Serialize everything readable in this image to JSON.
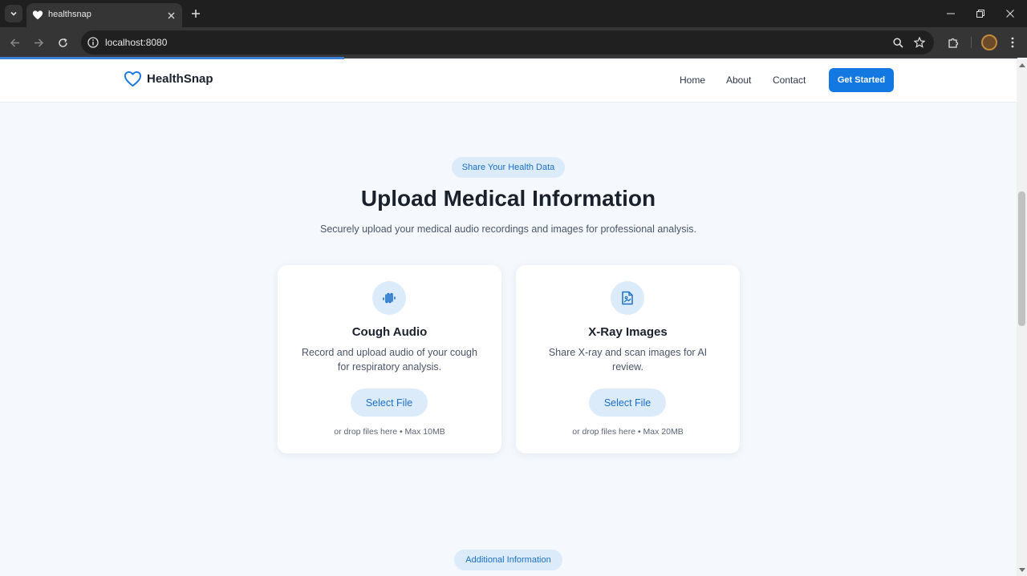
{
  "browser": {
    "tab_title": "healthsnap",
    "url": "localhost:8080",
    "load_progress": 0.338
  },
  "site": {
    "brand": "HealthSnap",
    "nav": [
      "Home",
      "About",
      "Contact"
    ],
    "cta_label": "Get Started",
    "accent": "#1478e3"
  },
  "hero": {
    "badge": "Share Your Health Data",
    "title": "Upload Medical Information",
    "subtitle": "Securely upload your medical audio recordings and images for professional analysis."
  },
  "cards": [
    {
      "icon": "audio-waveform-icon",
      "title": "Cough Audio",
      "description": "Record and upload audio of your cough for respiratory analysis.",
      "button": "Select File",
      "note": "or drop files here • Max 10MB"
    },
    {
      "icon": "image-file-icon",
      "title": "X-Ray Images",
      "description": "Share X-ray and scan images for AI review.",
      "button": "Select File",
      "note": "or drop files here • Max 20MB"
    }
  ],
  "next_section": {
    "badge": "Additional Information"
  }
}
